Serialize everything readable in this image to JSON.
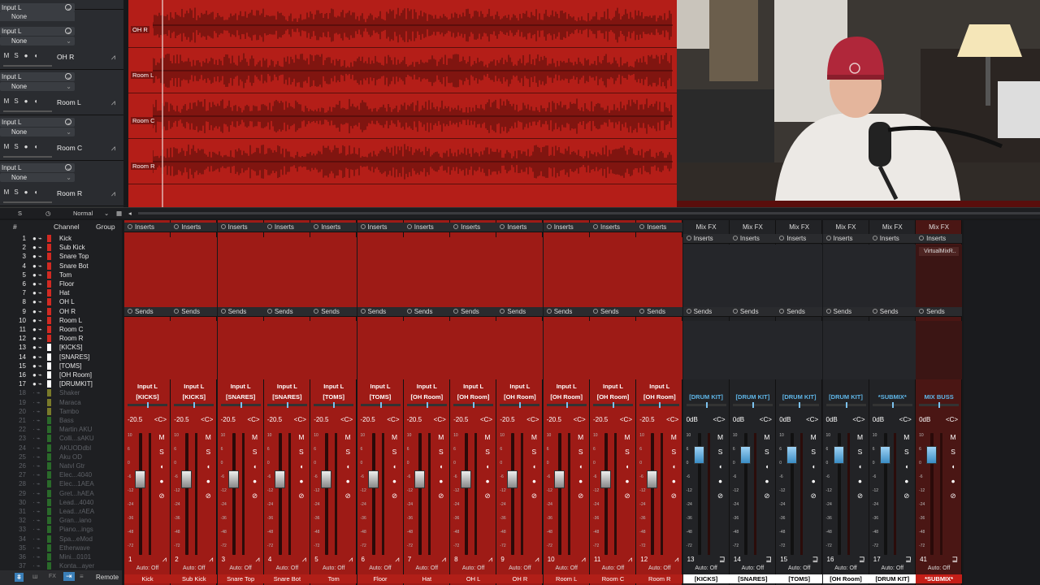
{
  "track_headers": [
    {
      "input": "Input L",
      "output": "None",
      "name": "OH R"
    },
    {
      "input": "Input L",
      "output": "None",
      "name": "Room L"
    },
    {
      "input": "Input L",
      "output": "None",
      "name": "Room C"
    },
    {
      "input": "Input L",
      "output": "None",
      "name": "Room R"
    }
  ],
  "top_track": {
    "input": "Input L",
    "output": "None"
  },
  "lanes": [
    "OH R",
    "Room L",
    "Room C",
    "Room R"
  ],
  "strip": {
    "s": "S",
    "mode": "Normal"
  },
  "channel_list": {
    "header_channel": "Channel",
    "header_group": "Group",
    "hash": "#",
    "rows": [
      {
        "n": "1",
        "name": "Kick",
        "color": "#d22a22",
        "active": true
      },
      {
        "n": "2",
        "name": "Sub Kick",
        "color": "#d22a22",
        "active": true
      },
      {
        "n": "3",
        "name": "Snare Top",
        "color": "#d22a22",
        "active": true
      },
      {
        "n": "4",
        "name": "Snare Bot",
        "color": "#d22a22",
        "active": true
      },
      {
        "n": "5",
        "name": "Tom",
        "color": "#d22a22",
        "active": true
      },
      {
        "n": "6",
        "name": "Floor",
        "color": "#d22a22",
        "active": true
      },
      {
        "n": "7",
        "name": "Hat",
        "color": "#d22a22",
        "active": true
      },
      {
        "n": "8",
        "name": "OH L",
        "color": "#d22a22",
        "active": true
      },
      {
        "n": "9",
        "name": "OH R",
        "color": "#d22a22",
        "active": true
      },
      {
        "n": "10",
        "name": "Room L",
        "color": "#d22a22",
        "active": true
      },
      {
        "n": "11",
        "name": "Room C",
        "color": "#d22a22",
        "active": true
      },
      {
        "n": "12",
        "name": "Room R",
        "color": "#d22a22",
        "active": true
      },
      {
        "n": "13",
        "name": "[KICKS]",
        "color": "#ffffff",
        "active": true
      },
      {
        "n": "14",
        "name": "[SNARES]",
        "color": "#ffffff",
        "active": true
      },
      {
        "n": "15",
        "name": "[TOMS]",
        "color": "#ffffff",
        "active": true
      },
      {
        "n": "16",
        "name": "[OH Room]",
        "color": "#ffffff",
        "active": true
      },
      {
        "n": "17",
        "name": "[DRUMKIT]",
        "color": "#ffffff",
        "active": true
      },
      {
        "n": "18",
        "name": "Shaker",
        "color": "#7a7a2a",
        "active": false
      },
      {
        "n": "19",
        "name": "Maraca",
        "color": "#7a7a2a",
        "active": false
      },
      {
        "n": "20",
        "name": "Tambo",
        "color": "#7a7a2a",
        "active": false
      },
      {
        "n": "21",
        "name": "Bass",
        "color": "#2a6a2a",
        "active": false
      },
      {
        "n": "22",
        "name": "Martin AKU",
        "color": "#2a6a2a",
        "active": false
      },
      {
        "n": "23",
        "name": "Colli...sAKU",
        "color": "#2a6a2a",
        "active": false
      },
      {
        "n": "24",
        "name": "AKUODdbl",
        "color": "#2a6a2a",
        "active": false
      },
      {
        "n": "25",
        "name": "Aku OD",
        "color": "#2a6a2a",
        "active": false
      },
      {
        "n": "26",
        "name": "Natvl Gtr",
        "color": "#2a6a2a",
        "active": false
      },
      {
        "n": "27",
        "name": "Elec...4040",
        "color": "#2a6a2a",
        "active": false
      },
      {
        "n": "28",
        "name": "Elec...1AEA",
        "color": "#2a6a2a",
        "active": false
      },
      {
        "n": "29",
        "name": "Gret...hAEA",
        "color": "#2a6a2a",
        "active": false
      },
      {
        "n": "30",
        "name": "Lead...4040",
        "color": "#2a6a2a",
        "active": false
      },
      {
        "n": "31",
        "name": "Lead...rAEA",
        "color": "#2a6a2a",
        "active": false
      },
      {
        "n": "32",
        "name": "Gran...iano",
        "color": "#2a6a2a",
        "active": false
      },
      {
        "n": "33",
        "name": "Piano...ings",
        "color": "#2a6a2a",
        "active": false
      },
      {
        "n": "34",
        "name": "Spa...eMod",
        "color": "#2a6a2a",
        "active": false
      },
      {
        "n": "35",
        "name": "Etherwave",
        "color": "#2a6a2a",
        "active": false
      },
      {
        "n": "36",
        "name": "Mini...0101",
        "color": "#2a6a2a",
        "active": false
      },
      {
        "n": "37",
        "name": "Konta...ayer",
        "color": "#2a6a2a",
        "active": false
      }
    ]
  },
  "bottom": {
    "remote": "Remote"
  },
  "mixer": {
    "inserts_label": "Inserts",
    "sends_label": "Sends",
    "mixfx_label": "Mix FX",
    "auto_label": "Auto: Off",
    "channels": [
      {
        "num": "1",
        "input": "Input L",
        "out": "[KICKS]",
        "gain": "-20.5",
        "pan": "<C>",
        "name": "Kick",
        "type": "red",
        "level": 0.62
      },
      {
        "num": "2",
        "input": "Input L",
        "out": "[KICKS]",
        "gain": "-20.5",
        "pan": "<C>",
        "name": "Sub Kick",
        "type": "red",
        "level": 0.62
      },
      {
        "num": "3",
        "input": "Input L",
        "out": "[SNARES]",
        "gain": "-20.5",
        "pan": "<C>",
        "name": "Snare Top",
        "type": "red",
        "level": 0.62
      },
      {
        "num": "4",
        "input": "Input L",
        "out": "[SNARES]",
        "gain": "-20.5",
        "pan": "<C>",
        "name": "Snare Bot",
        "type": "red",
        "level": 0.62
      },
      {
        "num": "5",
        "input": "Input L",
        "out": "[TOMS]",
        "gain": "-20.5",
        "pan": "<C>",
        "name": "Tom",
        "type": "red",
        "level": 0.62
      },
      {
        "num": "6",
        "input": "Input L",
        "out": "[TOMS]",
        "gain": "-20.5",
        "pan": "<C>",
        "name": "Floor",
        "type": "red",
        "level": 0.62
      },
      {
        "num": "7",
        "input": "Input L",
        "out": "[OH Room]",
        "gain": "-20.5",
        "pan": "<C>",
        "name": "Hat",
        "type": "red",
        "level": 0.62
      },
      {
        "num": "8",
        "input": "Input L",
        "out": "[OH Room]",
        "gain": "-20.5",
        "pan": "<C>",
        "name": "OH L",
        "type": "red",
        "level": 0.62
      },
      {
        "num": "9",
        "input": "Input L",
        "out": "[OH Room]",
        "gain": "-20.5",
        "pan": "<C>",
        "name": "OH R",
        "type": "red",
        "level": 0.62
      },
      {
        "num": "10",
        "input": "Input L",
        "out": "[OH Room]",
        "gain": "-20.5",
        "pan": "<C>",
        "name": "Room L",
        "type": "red",
        "level": 0.62
      },
      {
        "num": "11",
        "input": "Input L",
        "out": "[OH Room]",
        "gain": "-20.5",
        "pan": "<C>",
        "name": "Room C",
        "type": "red",
        "level": 0.62
      },
      {
        "num": "12",
        "input": "Input L",
        "out": "[OH Room]",
        "gain": "-20.5",
        "pan": "<C>",
        "name": "Room R",
        "type": "red",
        "level": 0.62
      },
      {
        "num": "13",
        "input": "",
        "out": "[DRUM KIT]",
        "gain": "0dB",
        "pan": "<C>",
        "name": "[KICKS]",
        "type": "dark",
        "level": 0.82
      },
      {
        "num": "14",
        "input": "",
        "out": "[DRUM KIT]",
        "gain": "0dB",
        "pan": "<C>",
        "name": "[SNARES]",
        "type": "dark",
        "level": 0.82
      },
      {
        "num": "15",
        "input": "",
        "out": "[DRUM KIT]",
        "gain": "0dB",
        "pan": "<C>",
        "name": "[TOMS]",
        "type": "dark",
        "level": 0.82
      },
      {
        "num": "16",
        "input": "",
        "out": "[DRUM KIT]",
        "gain": "0dB",
        "pan": "<C>",
        "name": "[OH Room]",
        "type": "dark",
        "level": 0.82
      },
      {
        "num": "17",
        "input": "",
        "out": "*SUBMIX*",
        "gain": "0dB",
        "pan": "<C>",
        "name": "[DRUM KIT]",
        "type": "dark",
        "level": 0.82
      },
      {
        "num": "41",
        "input": "",
        "out": "MIX BUSS",
        "gain": "0dB",
        "pan": "<C>",
        "name": "*SUBMIX*",
        "type": "bus",
        "level": 0.82,
        "plugin": "VirtualMixR.."
      }
    ]
  },
  "colors": {
    "track_red": "#b41e18",
    "group_blue": "#5fb6e8"
  }
}
